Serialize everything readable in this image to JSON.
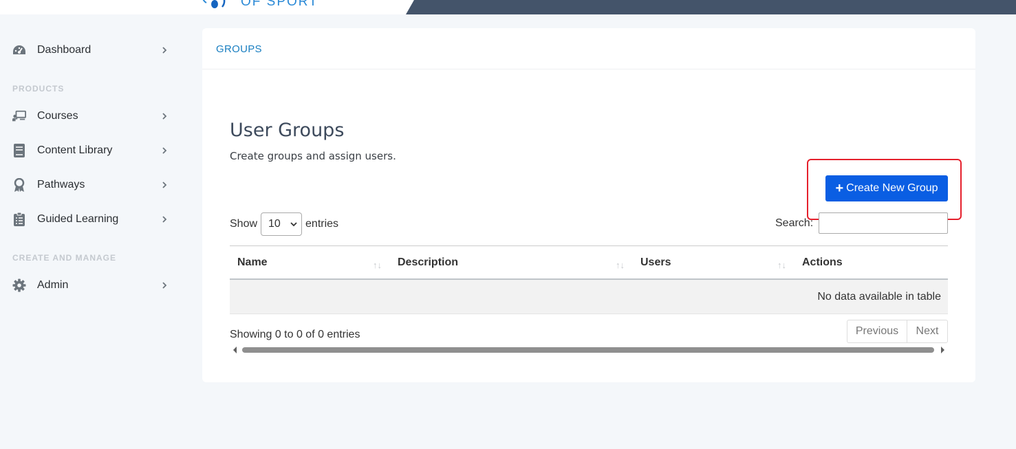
{
  "topbar": {
    "logo_text": "OF SPORT",
    "accent": "#44546a"
  },
  "sidebar": {
    "items": [
      {
        "label": "Dashboard",
        "icon": "gauge-icon"
      },
      {
        "label": "Courses",
        "icon": "presentation-icon"
      },
      {
        "label": "Content Library",
        "icon": "book-icon"
      },
      {
        "label": "Pathways",
        "icon": "award-icon"
      },
      {
        "label": "Guided Learning",
        "icon": "clipboard-list-icon"
      },
      {
        "label": "Admin",
        "icon": "gear-icon"
      }
    ],
    "sections": [
      "PRODUCTS",
      "CREATE AND MANAGE"
    ]
  },
  "card": {
    "header_title": "GROUPS",
    "page_title": "User Groups",
    "page_subtitle": "Create groups and assign users.",
    "create_button": "Create New Group",
    "show_label": "Show",
    "entries_label": "entries",
    "page_size": "10",
    "search_label": "Search:",
    "search_value": "",
    "columns": [
      "Name",
      "Description",
      "Users",
      "Actions"
    ],
    "empty_message": "No data available in table",
    "info_text": "Showing 0 to 0 of 0 entries",
    "pager": {
      "previous": "Previous",
      "next": "Next"
    }
  },
  "colors": {
    "primary_button": "#0a5ee3",
    "link": "#1a7fc1",
    "highlight_box": "#e5202c"
  }
}
